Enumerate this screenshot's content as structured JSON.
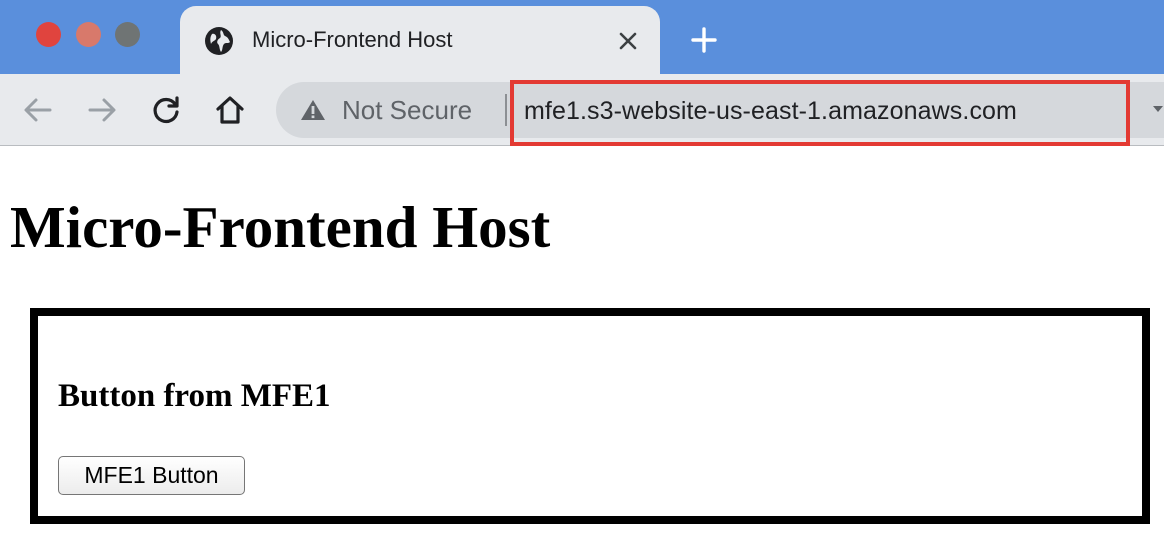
{
  "browser": {
    "window_controls": [
      "close",
      "minimize",
      "zoom"
    ],
    "tab": {
      "favicon": "globe-icon",
      "title": "Micro-Frontend Host",
      "close_icon": "close-icon"
    },
    "new_tab_icon": "plus-icon",
    "toolbar": {
      "back_icon": "arrow-left-icon",
      "forward_icon": "arrow-right-icon",
      "reload_icon": "reload-icon",
      "home_icon": "home-icon"
    },
    "omnibox": {
      "security_icon": "warning-icon",
      "security_label": "Not Secure",
      "url": "mfe1.s3-website-us-east-1.amazonaws.com",
      "highlight_color": "#e33a33"
    },
    "colors": {
      "tabstrip": "#5a8fdc",
      "toolbar": "#e8eaed",
      "omnibox": "#d5d8dc"
    }
  },
  "page": {
    "heading": "Micro-Frontend Host",
    "mfe": {
      "heading": "Button from MFE1",
      "button_label": "MFE1 Button"
    }
  }
}
